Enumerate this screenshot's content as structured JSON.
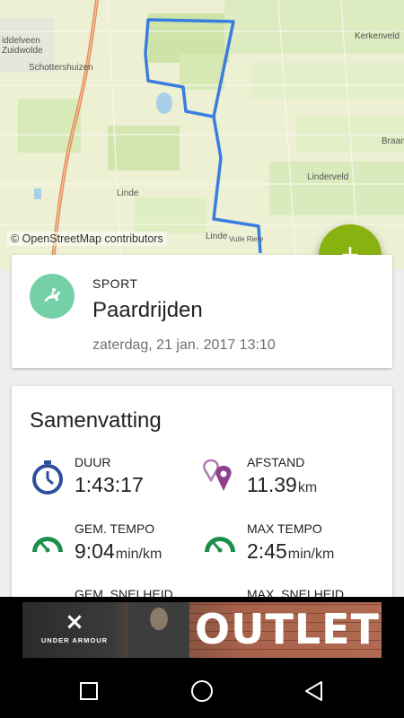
{
  "map": {
    "attribution": "© OpenStreetMap contributors",
    "labels": {
      "middelveen": "iddelveen",
      "zuidwolde": "Zuidwolde",
      "schottershuizen": "Schottershuizen",
      "kerkenveld": "Kerkenveld",
      "braam": "Braam",
      "linderveld": "Linderveld",
      "linde_west": "Linde",
      "linde_south": "Linde",
      "vuile_riete": "Vuile Riete"
    },
    "route_color": "#3a7de0",
    "road_color": "#e08a5a"
  },
  "fab": {
    "icon": "plus-icon",
    "symbol": "+"
  },
  "sport": {
    "label": "SPORT",
    "name": "Paardrijden",
    "date": "zaterdag, 21 jan. 2017 13:10",
    "icon": "horse-riding-icon",
    "icon_color": "#74d0a6"
  },
  "summary": {
    "title": "Samenvatting",
    "metrics": [
      {
        "label": "DUUR",
        "value": "1:43:17",
        "unit": "",
        "icon": "stopwatch-icon",
        "color": "#2e4f9e"
      },
      {
        "label": "AFSTAND",
        "value": "11.39",
        "unit": "km",
        "icon": "location-pins-icon",
        "color": "#8e3f8f"
      },
      {
        "label": "GEM. TEMPO",
        "value": "9:04",
        "unit": "min/km",
        "icon": "speedometer-icon",
        "color": "#1b8f4a"
      },
      {
        "label": "MAX TEMPO",
        "value": "2:45",
        "unit": "min/km",
        "icon": "speedometer-icon",
        "color": "#1b8f4a"
      },
      {
        "label": "GEM. SNELHEID",
        "value": "",
        "unit": "",
        "icon": "speedometer-icon",
        "color": "#1b8f4a"
      },
      {
        "label": "MAX. SNELHEID",
        "value": "",
        "unit": "",
        "icon": "speedometer-icon",
        "color": "#1b8f4a"
      }
    ]
  },
  "ad": {
    "brand": "UNDER ARMOUR",
    "text": "OUTLET"
  },
  "navbar": {
    "recents": "square-icon",
    "home": "circle-icon",
    "back": "triangle-back-icon"
  }
}
